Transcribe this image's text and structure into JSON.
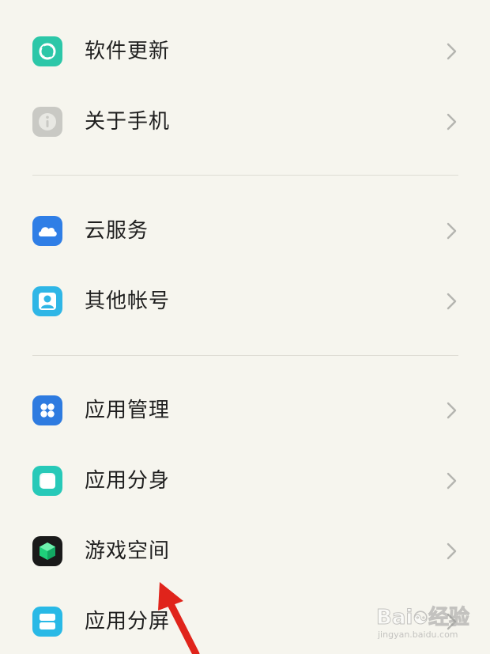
{
  "settings": {
    "groups": [
      {
        "items": [
          {
            "label": "软件更新",
            "icon": "software-update-icon",
            "icon_color": "#2cc7a8"
          },
          {
            "label": "关于手机",
            "icon": "info-icon",
            "icon_color": "#c9c9c4"
          }
        ]
      },
      {
        "items": [
          {
            "label": "云服务",
            "icon": "cloud-icon",
            "icon_color": "#2f7ee6"
          },
          {
            "label": "其他帐号",
            "icon": "account-icon",
            "icon_color": "#2fb6e6"
          }
        ]
      },
      {
        "items": [
          {
            "label": "应用管理",
            "icon": "app-management-icon",
            "icon_color": "#2e7be0"
          },
          {
            "label": "应用分身",
            "icon": "app-clone-icon",
            "icon_color": "#27c9b8"
          },
          {
            "label": "游戏空间",
            "icon": "game-space-icon",
            "icon_color": "#1a1a1a"
          },
          {
            "label": "应用分屏",
            "icon": "split-screen-icon",
            "icon_color": "#29b9e6"
          }
        ]
      }
    ]
  },
  "annotation": {
    "arrow_color": "#e0241b",
    "points_to": "游戏空间"
  },
  "watermark": {
    "brand": "Bai",
    "brand_suffix": "经验",
    "domain": "jingyan.baidu.com"
  },
  "colors": {
    "background": "#f6f5ee",
    "divider": "#dedcd4",
    "chevron": "#b5b5b0",
    "text": "#1f1f1f"
  }
}
